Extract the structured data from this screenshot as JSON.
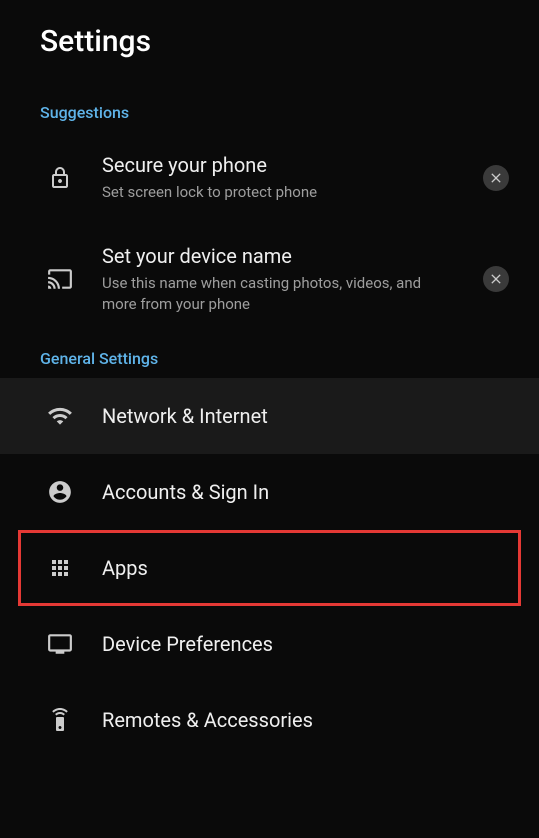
{
  "header": {
    "title": "Settings"
  },
  "sections": {
    "suggestions": {
      "header": "Suggestions",
      "items": [
        {
          "title": "Secure your phone",
          "subtitle": "Set screen lock to protect phone"
        },
        {
          "title": "Set your device name",
          "subtitle": "Use this name when casting photos, videos, and more from your phone"
        }
      ]
    },
    "general": {
      "header": "General Settings",
      "items": [
        {
          "title": "Network & Internet"
        },
        {
          "title": "Accounts & Sign In"
        },
        {
          "title": "Apps"
        },
        {
          "title": "Device Preferences"
        },
        {
          "title": "Remotes & Accessories"
        }
      ]
    }
  }
}
